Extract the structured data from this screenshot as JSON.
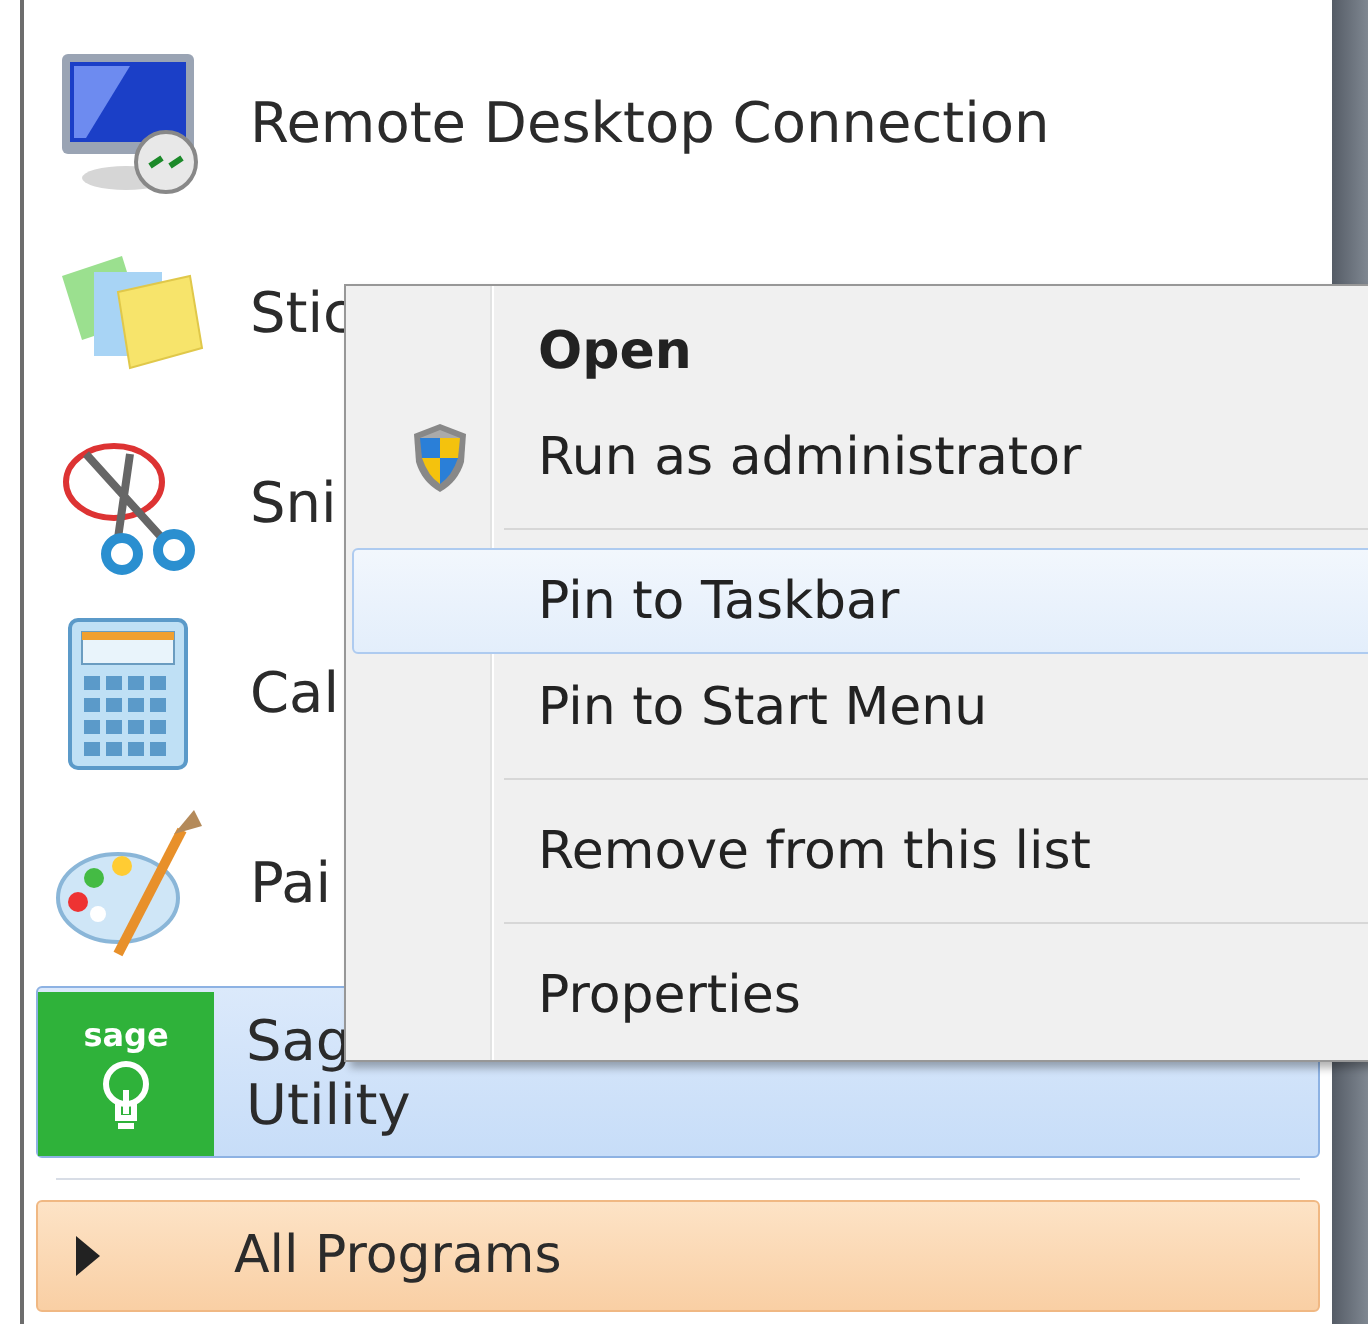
{
  "programs": [
    {
      "kind": "remote",
      "lines": [
        "Remote Desktop Connection"
      ],
      "selected": false
    },
    {
      "kind": "sticky",
      "lines": [
        "Stic"
      ],
      "selected": false
    },
    {
      "kind": "snip",
      "lines": [
        "Sni"
      ],
      "selected": false
    },
    {
      "kind": "calc",
      "lines": [
        "Cal"
      ],
      "selected": false
    },
    {
      "kind": "paint",
      "lines": [
        "Pai"
      ],
      "selected": false
    },
    {
      "kind": "sage",
      "icon_text": "sage",
      "lines": [
        "Sag",
        "Utility"
      ],
      "selected": true
    }
  ],
  "all_programs": {
    "label": "All Programs"
  },
  "context_menu": {
    "groups": [
      [
        {
          "label": "Open",
          "bold": true,
          "shield": false,
          "selected": false
        },
        {
          "label": "Run as administrator",
          "bold": false,
          "shield": true,
          "selected": false
        }
      ],
      [
        {
          "label": "Pin to Taskbar",
          "bold": false,
          "shield": false,
          "selected": true
        },
        {
          "label": "Pin to Start Menu",
          "bold": false,
          "shield": false,
          "selected": false
        }
      ],
      [
        {
          "label": "Remove from this list",
          "bold": false,
          "shield": false,
          "selected": false
        }
      ],
      [
        {
          "label": "Properties",
          "bold": false,
          "shield": false,
          "selected": false
        }
      ]
    ]
  }
}
